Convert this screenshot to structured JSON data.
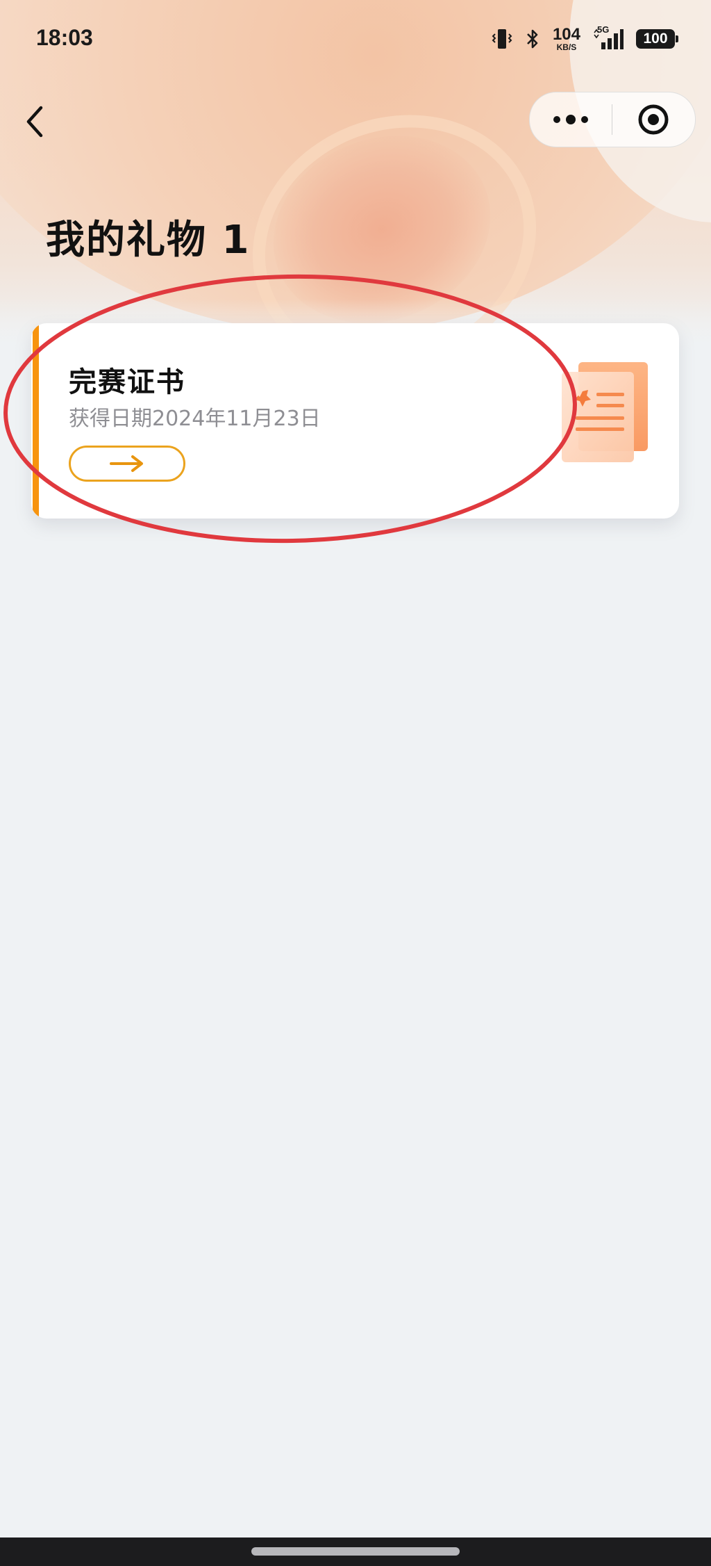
{
  "status_bar": {
    "time": "18:03",
    "net_speed_value": "104",
    "net_speed_unit": "KB/S",
    "network_type": "5G",
    "battery": "100",
    "icons": [
      "vibrate-icon",
      "bluetooth-icon",
      "signal-icon",
      "battery-icon"
    ]
  },
  "nav": {
    "back_icon": "chevron-left-icon",
    "more_icon": "more-dots-icon",
    "close_icon": "target-circle-icon"
  },
  "page": {
    "title": "我的礼物 1"
  },
  "gifts": [
    {
      "title": "完赛证书",
      "date_text": "获得日期2024年11月23日",
      "action_icon": "arrow-right-icon",
      "illustration": "certificate-icon"
    }
  ],
  "colors": {
    "accent": "#f7940f",
    "button_border": "#eba31e",
    "annotation": "#e0393e",
    "background": "#eff2f4"
  }
}
